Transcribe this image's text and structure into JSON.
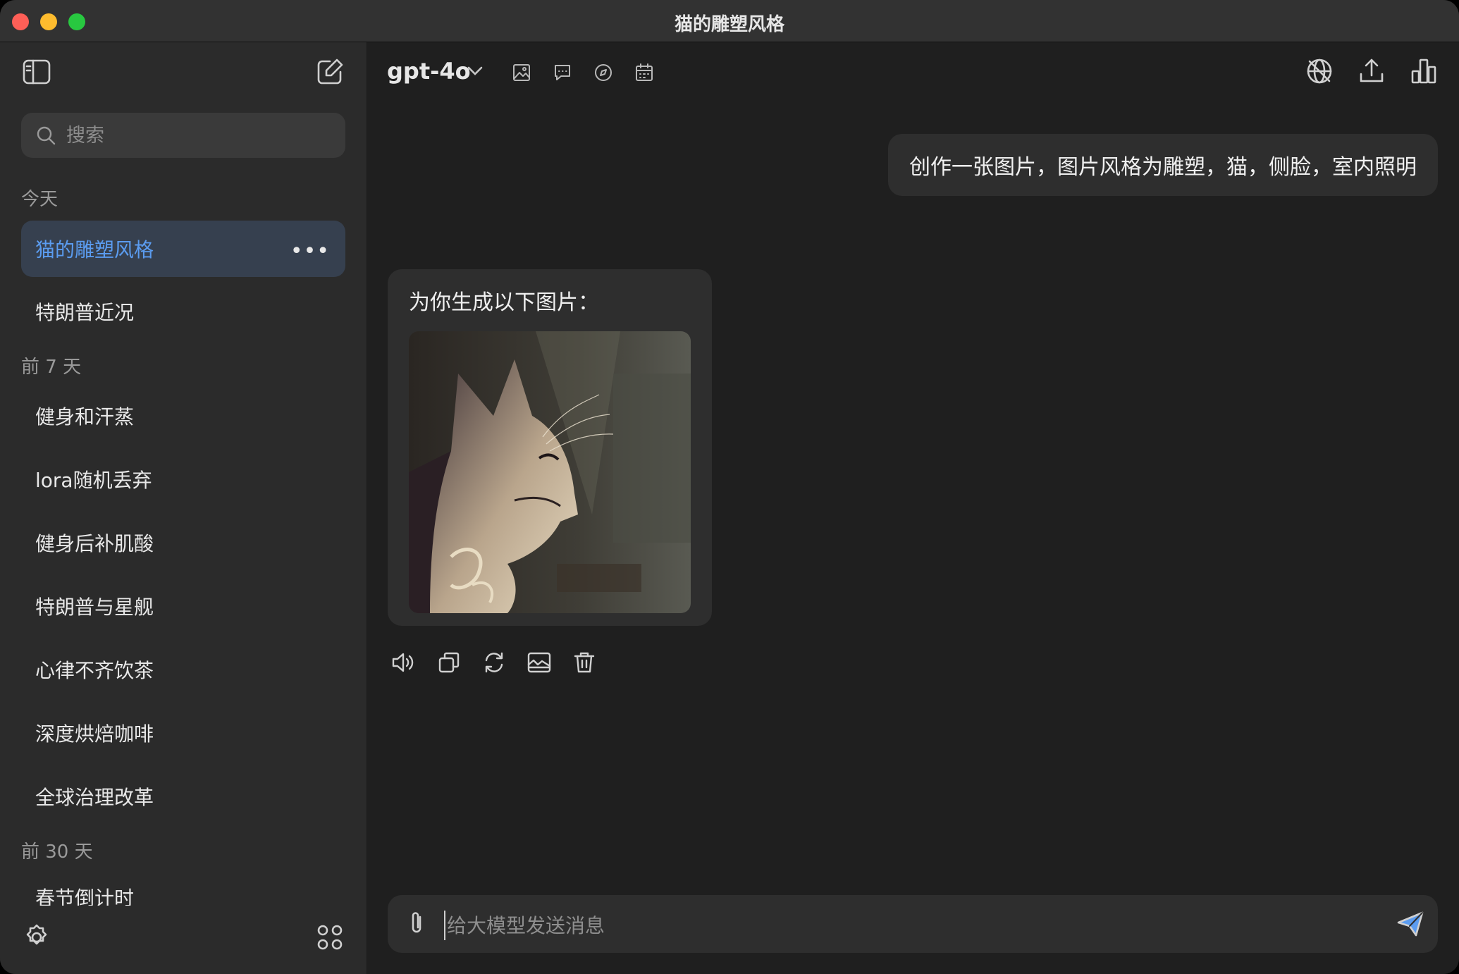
{
  "window": {
    "title": "猫的雕塑风格"
  },
  "sidebar": {
    "search_placeholder": "搜索",
    "sections": [
      {
        "label": "今天",
        "items": [
          "猫的雕塑风格",
          "特朗普近况"
        ]
      },
      {
        "label": "前 7 天",
        "items": [
          "健身和汗蒸",
          "lora随机丢弃",
          "健身后补肌酸",
          "特朗普与星舰",
          "心律不齐饮茶",
          "深度烘焙咖啡",
          "全球治理改革"
        ]
      },
      {
        "label": "前 30 天",
        "items": [
          "春节倒计时"
        ]
      }
    ],
    "active_item": "猫的雕塑风格",
    "icons": {
      "toggle": "sidebar-toggle-icon",
      "new_chat": "new-chat-icon",
      "settings": "gear-icon",
      "apps": "apps-grid-icon",
      "more": "more-icon"
    }
  },
  "header": {
    "model": "gpt-4o",
    "tools": [
      "image-icon",
      "chat-bubble-icon",
      "compass-icon",
      "calendar-icon"
    ],
    "right_icons": [
      "web-off-icon",
      "share-icon",
      "stats-icon"
    ]
  },
  "messages": {
    "user": "创作一张图片，图片风格为雕塑，猫，侧脸，室内照明",
    "assistant_text": "为你生成以下图片：",
    "assistant_image": "sculpted-cat-profile-image",
    "actions": [
      "speaker-icon",
      "copy-icon",
      "regenerate-icon",
      "image-action-icon",
      "trash-icon"
    ]
  },
  "composer": {
    "placeholder": "给大模型发送消息"
  },
  "colors": {
    "accent": "#5b9cf0",
    "sidebar_bg": "#2b2b2b",
    "main_bg": "#1f1f1f",
    "bubble_bg": "#2e2e2e"
  }
}
